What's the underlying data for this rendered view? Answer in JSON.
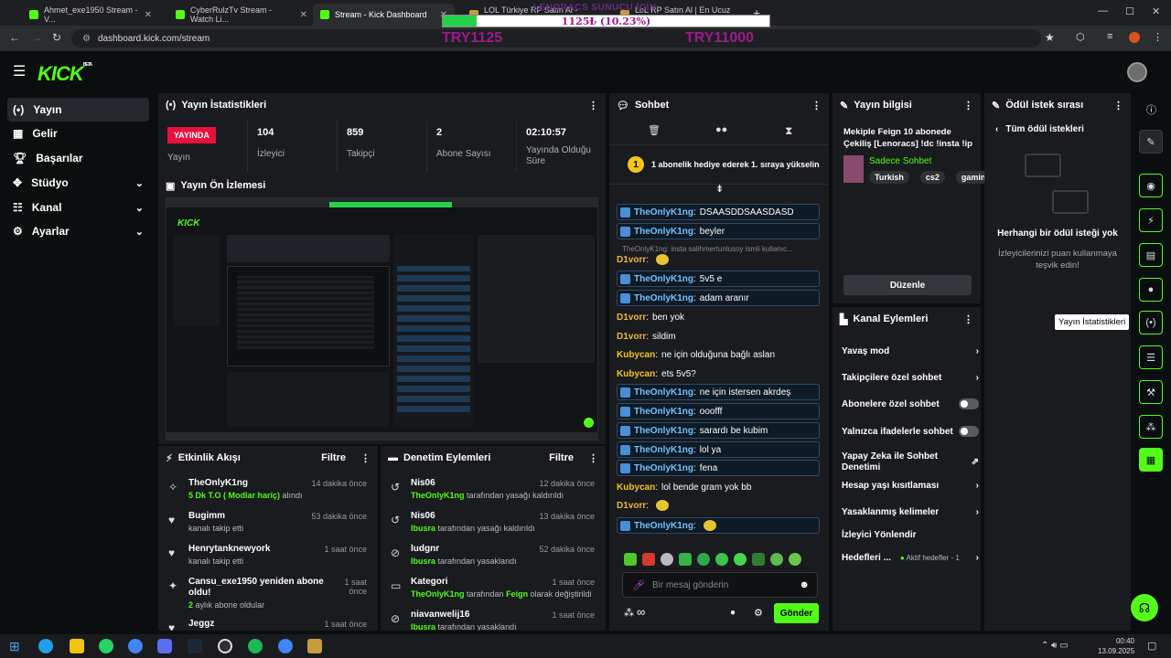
{
  "browser": {
    "tabs": [
      {
        "label": "Ahmet_exe1950 Stream - V..."
      },
      {
        "label": "CyberRulzTv Stream - Watch Li..."
      },
      {
        "label": "Stream - Kick Dashboard"
      },
      {
        "label": "LOL Türkiye RP Satın Al - Bakın..."
      },
      {
        "label": "LoL RP Satın Al | En Ucuz Lega..."
      }
    ],
    "url": "dashboard.kick.com/stream"
  },
  "overlay": {
    "title": "LENORACS SUNUCU İÇİN",
    "progress_text": "1125₺ (10.23%)",
    "progress_fraction": 0.1023,
    "current": "TRY1125",
    "goal": "TRY11000"
  },
  "logo": {
    "text": "KICK",
    "badge": "BETA"
  },
  "nav": {
    "items": [
      {
        "label": "Yayın"
      },
      {
        "label": "Gelir"
      },
      {
        "label": "Başarılar"
      },
      {
        "label": "Stüdyo"
      },
      {
        "label": "Kanal"
      },
      {
        "label": "Ayarlar"
      }
    ]
  },
  "stats": {
    "title": "Yayın İstatistikleri",
    "live_badge": "YAYINDA",
    "live_label": "Yayın",
    "viewers": "104",
    "viewers_label": "İzleyici",
    "followers": "859",
    "followers_label": "Takipçi",
    "subs": "2",
    "subs_label": "Abone Sayısı",
    "uptime": "02:10:57",
    "uptime_label": "Yayında Olduğu Süre"
  },
  "preview": {
    "title": "Yayın Ön İzlemesi"
  },
  "activity": {
    "title": "Etkinlik Akışı",
    "filter": "Filtre",
    "items": [
      {
        "name": "TheOnlyK1ng",
        "highlight": "5 Dk T.O ( Modlar hariç)",
        "rest": " alındı",
        "time": "14 dakika önce"
      },
      {
        "name": "Bugimm",
        "highlight": "",
        "rest": "kanalı takip etti",
        "time": "53 dakika önce"
      },
      {
        "name": "Henrytanknewyork",
        "highlight": "",
        "rest": "kanalı takip etti",
        "time": "1 saat önce"
      },
      {
        "name": "Cansu_exe1950 yeniden abone oldu!",
        "highlight": "2",
        "rest": " aylık abone oldular",
        "time": "1 saat önce"
      },
      {
        "name": "Jeggz",
        "highlight": "",
        "rest": "",
        "time": "1 saat önce"
      }
    ]
  },
  "moderation": {
    "title": "Denetim Eylemleri",
    "filter": "Filtre",
    "items": [
      {
        "name": "Nis06",
        "actor": "TheOnlyK1ng",
        "rest": " tarafından yasağı kaldırıldı",
        "extra": "",
        "time": "12 dakika önce"
      },
      {
        "name": "Nis06",
        "actor": "Ibusra",
        "rest": " tarafından yasağı kaldırıldı",
        "extra": "",
        "time": "13 dakika önce"
      },
      {
        "name": "ludgnr",
        "actor": "Ibusra",
        "rest": " tarafından yasaklandı",
        "extra": "",
        "time": "52 dakika önce"
      },
      {
        "name": "Kategori",
        "actor": "TheOnlyK1ng",
        "rest": " tarafından ",
        "extra": "Feign",
        "extra_rest": " olarak değiştirildi",
        "time": "1 saat önce"
      },
      {
        "name": "niavanwelij16",
        "actor": "Ibusra",
        "rest": " tarafından yasaklandı",
        "extra": "",
        "time": "1 saat önce"
      }
    ]
  },
  "chat": {
    "title": "Sohbet",
    "pinned": "1 abonelik hediye ederek 1. sıraya yükselin",
    "pinned_num": "1",
    "reply_hint": "TheOnlyK1ng: insta salihmertunlusoy ismli kullanıc...",
    "messages": [
      {
        "user": "TheOnlyK1ng",
        "text": "DSAASDDSAASDASD",
        "hl": true
      },
      {
        "user": "TheOnlyK1ng",
        "text": "beyler",
        "hl": true
      },
      {
        "user": "D1vorr",
        "text": "",
        "hl": false
      },
      {
        "user": "TheOnlyK1ng",
        "text": "5v5 e",
        "hl": true
      },
      {
        "user": "TheOnlyK1ng",
        "text": "adam aranır",
        "hl": true
      },
      {
        "user": "D1vorr",
        "text": "ben yok",
        "hl": false
      },
      {
        "user": "D1vorr",
        "text": "sildim",
        "hl": false
      },
      {
        "user": "Kubycan",
        "text": "ne için olduğuna bağlı aslan",
        "hl": false
      },
      {
        "user": "Kubycan",
        "text": "ets 5v5?",
        "hl": false
      },
      {
        "user": "TheOnlyK1ng",
        "text": "ne için istersen akrdeş",
        "hl": true
      },
      {
        "user": "TheOnlyK1ng",
        "text": "ooofff",
        "hl": true
      },
      {
        "user": "TheOnlyK1ng",
        "text": "sarardı be kubim",
        "hl": true
      },
      {
        "user": "TheOnlyK1ng",
        "text": "lol ya",
        "hl": true
      },
      {
        "user": "TheOnlyK1ng",
        "text": "fena",
        "hl": true
      },
      {
        "user": "Kubycan",
        "text": "lol bende gram yok bb",
        "hl": false
      },
      {
        "user": "D1vorr",
        "text": "",
        "hl": false
      },
      {
        "user": "TheOnlyK1ng",
        "text": "",
        "hl": true
      }
    ],
    "input_placeholder": "Bir mesaj gönderin",
    "send": "Gönder",
    "infinity": "∞"
  },
  "info": {
    "title": "Yayın bilgisi",
    "stream_title": "Mekiple Feign 10 abonede Çekiliş [Lenoracs] !dc !insta !ip",
    "category": "Sadece Sohbet",
    "tags": [
      "Turkish",
      "cs2",
      "gaming"
    ],
    "edit": "Düzenle"
  },
  "channel_actions": {
    "title": "Kanal Eylemleri",
    "items": [
      {
        "label": "Yavaş mod",
        "kind": "chevron"
      },
      {
        "label": "Takipçilere özel sohbet",
        "kind": "chevron"
      },
      {
        "label": "Abonelere özel sohbet",
        "kind": "toggle"
      },
      {
        "label": "Yalnızca ifadelerle sohbet",
        "kind": "toggle"
      },
      {
        "label": "Yapay Zeka ile Sohbet Denetimi",
        "kind": "external"
      },
      {
        "label": "Hesap yaşı kısıtlaması",
        "kind": "chevron"
      },
      {
        "label": "Yasaklanmış kelimeler",
        "kind": "chevron"
      },
      {
        "label": "İzleyici Yönlendir",
        "kind": "none"
      },
      {
        "label": "Hedefleri ...",
        "kind": "goal",
        "extra": "Aktif hedefler - 1"
      }
    ]
  },
  "rewards": {
    "title": "Ödül istek sırası",
    "back": "Tüm ödül istekleri",
    "empty_title": "Herhangi bir ödül isteği yok",
    "empty_desc": "İzleyicilerinizi puan kullanmaya teşvik edin!"
  },
  "tooltip": "Yayın İstatistikleri",
  "taskbar": {
    "time": "00:40",
    "date": "13.09.2025"
  }
}
